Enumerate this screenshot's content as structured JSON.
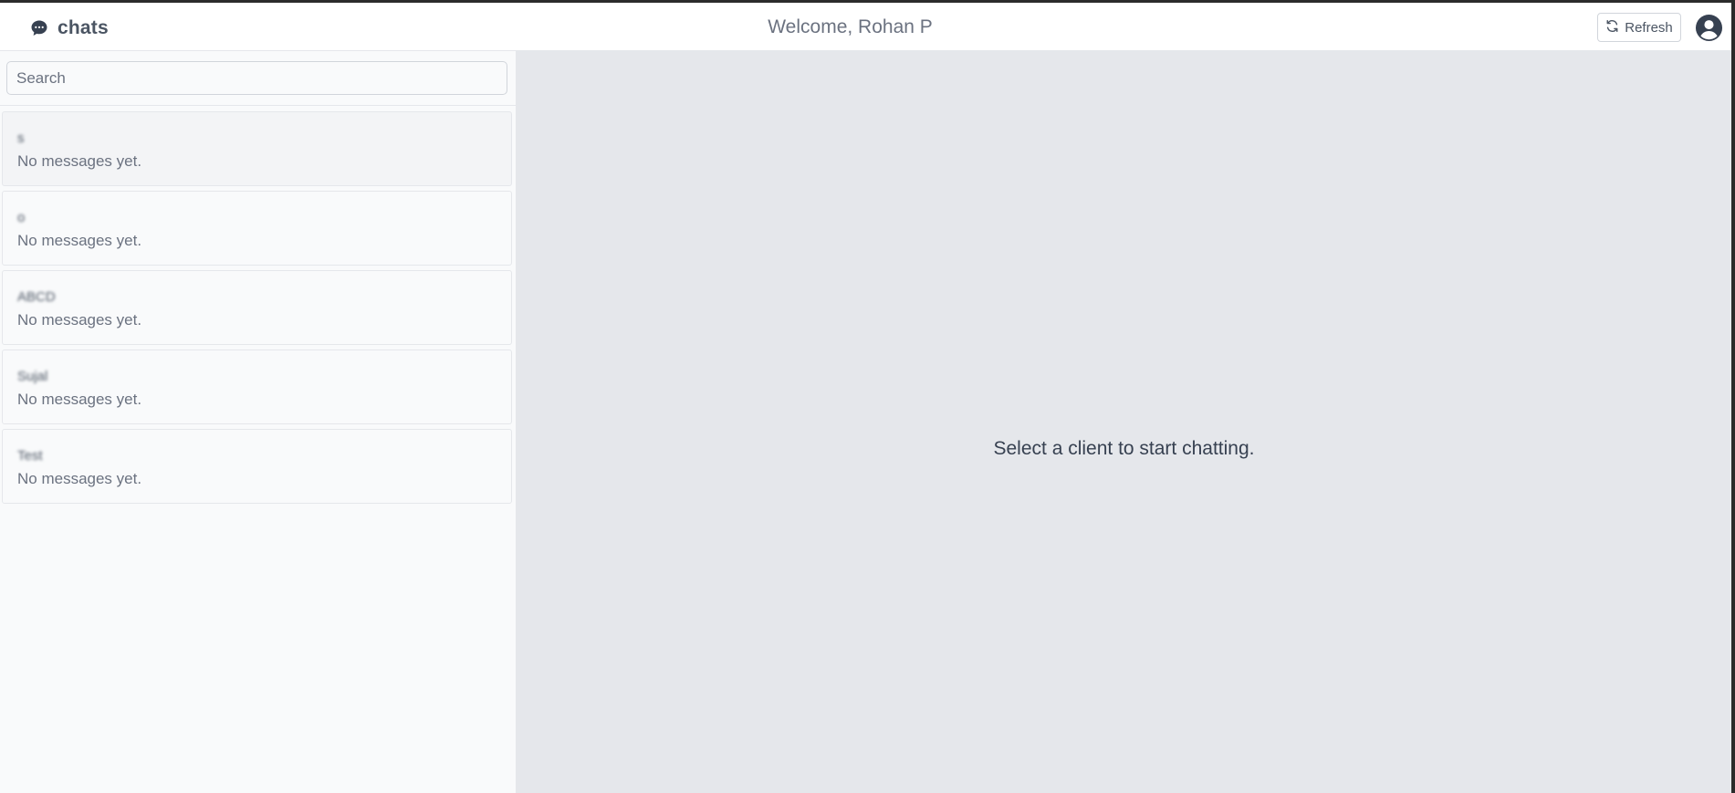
{
  "header": {
    "brand_icon": "chat-bubble-icon",
    "brand_label": "chats",
    "welcome": "Welcome, Rohan P",
    "refresh_icon": "refresh-icon",
    "refresh_label": "Refresh",
    "avatar_icon": "user-circle-icon"
  },
  "sidebar": {
    "search": {
      "placeholder": "Search",
      "value": ""
    },
    "chats": [
      {
        "name": "s",
        "preview": "No messages yet."
      },
      {
        "name": "o",
        "preview": "No messages yet."
      },
      {
        "name": "ABCD",
        "preview": "No messages yet."
      },
      {
        "name": "Sujal",
        "preview": "No messages yet."
      },
      {
        "name": "Test",
        "preview": "No messages yet."
      }
    ]
  },
  "main": {
    "empty_message": "Select a client to start chatting."
  },
  "colors": {
    "topbar_bg": "#ffffff",
    "sidebar_bg": "#f9fafb",
    "main_bg": "#e5e7eb",
    "border": "#e5e7eb",
    "text_primary": "#374151",
    "text_muted": "#6b7280",
    "icon": "#374151"
  }
}
